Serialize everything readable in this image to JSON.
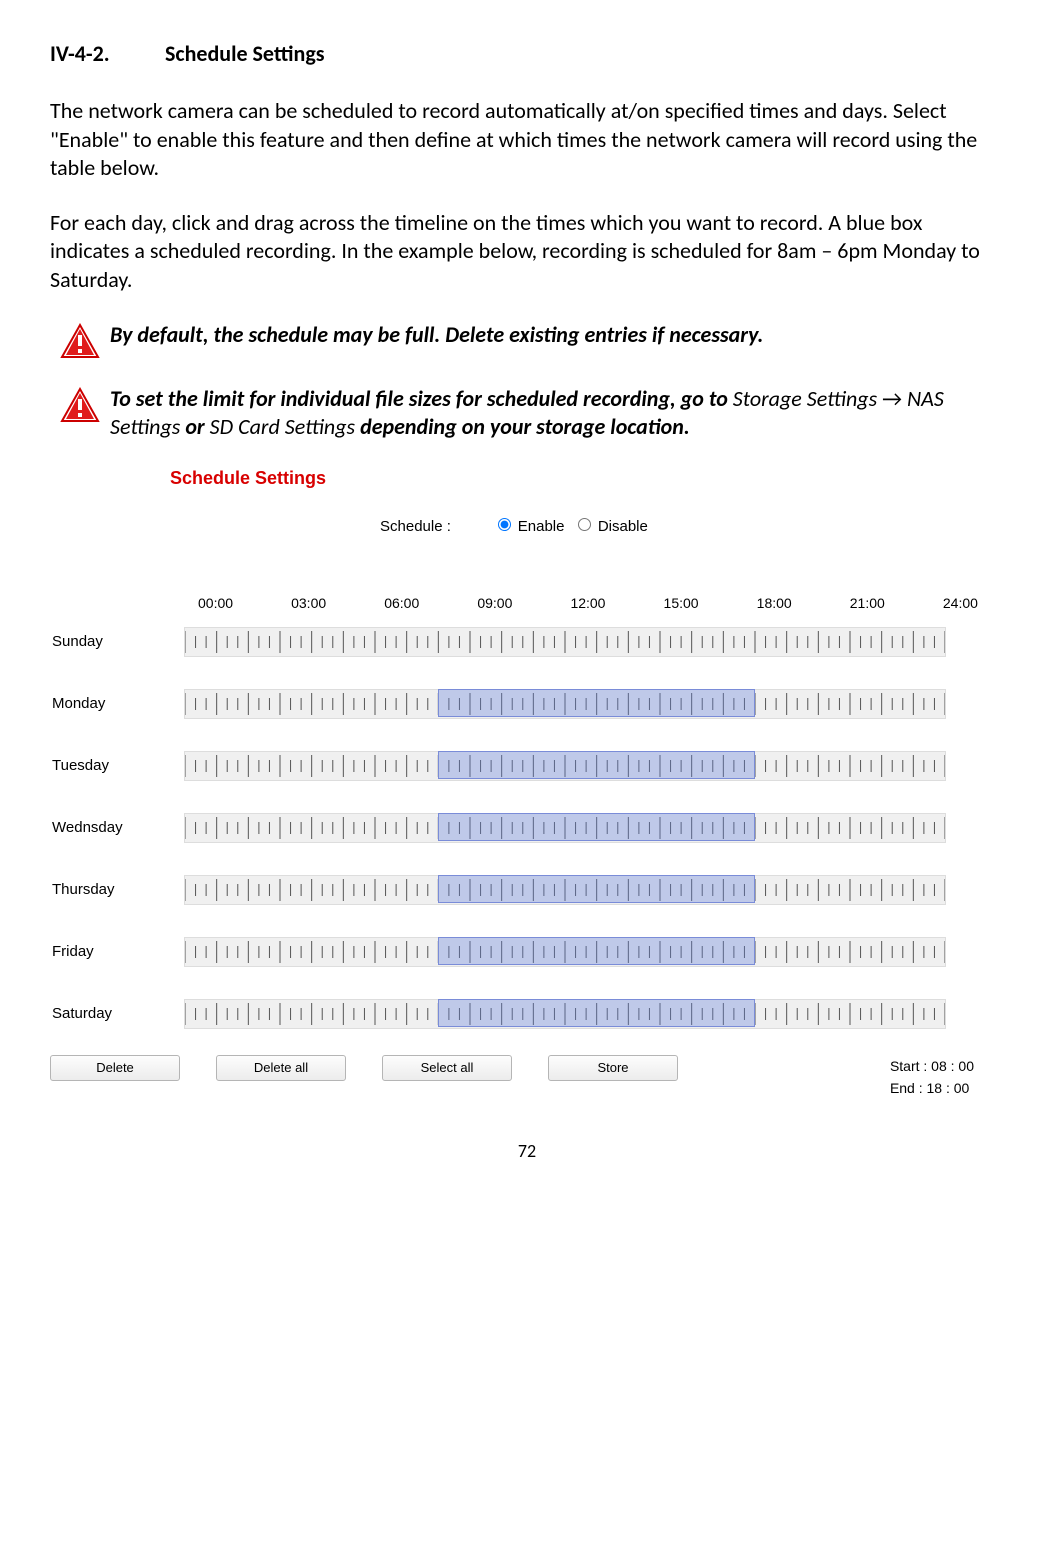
{
  "heading": {
    "number": "IV-4-2.",
    "title": "Schedule Settings"
  },
  "para1": "The network camera can be scheduled to record automatically at/on specified times and days. Select \"Enable\" to enable this feature and then define at which times the network camera will record using the table below.",
  "para2": "For each day, click and drag across the timeline on the times which you want to record. A blue box indicates a scheduled recording. In the example below, recording is scheduled for 8am – 6pm Monday to Saturday.",
  "note1": "By default, the schedule may be full. Delete existing entries if necessary.",
  "note2_pre": "To set the limit for individual file sizes for scheduled recording, go to ",
  "note2_storage": "Storage Settings ",
  "note2_arrow": "→",
  "note2_nas": " NAS Settings ",
  "note2_or": "or ",
  "note2_sd": "SD Card Settings ",
  "note2_post": "depending on your storage location.",
  "panel_title": "Schedule Settings",
  "enable": {
    "label": "Schedule :",
    "opt_enable": "Enable",
    "opt_disable": "Disable",
    "selected": "enable"
  },
  "hours": [
    "00:00",
    "03:00",
    "06:00",
    "09:00",
    "12:00",
    "15:00",
    "18:00",
    "21:00",
    "24:00"
  ],
  "days": [
    {
      "label": "Sunday",
      "sel": null
    },
    {
      "label": "Monday",
      "sel": {
        "start": 8,
        "end": 18
      }
    },
    {
      "label": "Tuesday",
      "sel": {
        "start": 8,
        "end": 18
      }
    },
    {
      "label": "Wednsday",
      "sel": {
        "start": 8,
        "end": 18
      }
    },
    {
      "label": "Thursday",
      "sel": {
        "start": 8,
        "end": 18
      }
    },
    {
      "label": "Friday",
      "sel": {
        "start": 8,
        "end": 18
      }
    },
    {
      "label": "Saturday",
      "sel": {
        "start": 8,
        "end": 18
      }
    }
  ],
  "buttons": {
    "delete": "Delete",
    "delete_all": "Delete all",
    "select_all": "Select all",
    "store": "Store"
  },
  "range": {
    "start": "Start : 08 : 00",
    "end": "End : 18 : 00"
  },
  "page": "72",
  "total_hours": 24,
  "tick_divisions": 72
}
